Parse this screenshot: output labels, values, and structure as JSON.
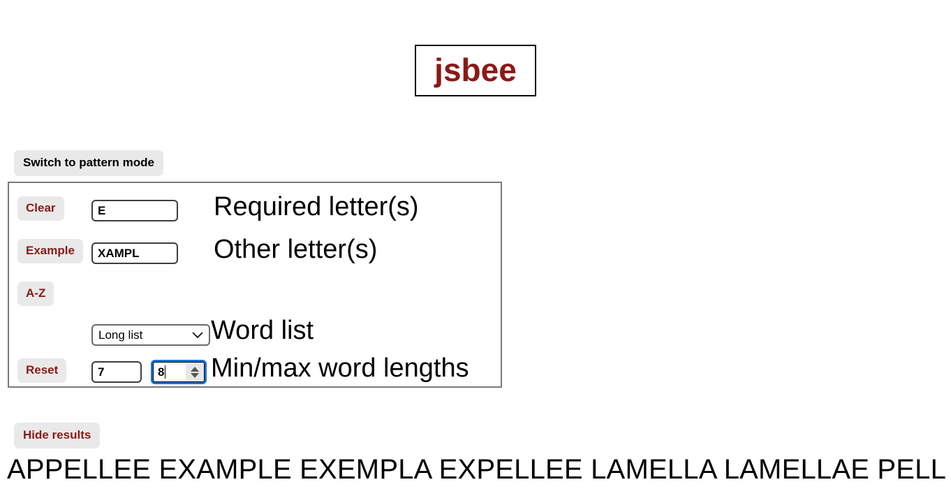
{
  "app": {
    "title": "jsbee"
  },
  "mode": {
    "switch_label": "Switch to pattern mode"
  },
  "panel": {
    "rows": [
      {
        "button": "Clear",
        "input_value": "E",
        "label": "Required letter(s)"
      },
      {
        "button": "Example",
        "input_value": "XAMPL",
        "label": "Other letter(s)"
      },
      {
        "button": "A-Z",
        "input_value": "",
        "label": ""
      },
      {
        "button": "",
        "select_value": "Long list",
        "label": "Word list"
      },
      {
        "button": "Reset",
        "min_value": "7",
        "max_value": "8",
        "label": "Min/max word lengths"
      }
    ],
    "wordlist_options": [
      "Long list"
    ]
  },
  "results": {
    "toggle_label": "Hide results",
    "words": [
      "APPELLEE",
      "EXAMPLE",
      "EXEMPLA",
      "EXPELLEE",
      "LAMELLA",
      "LAMELLAE",
      "PELLMELL"
    ],
    "text": "APPELLEE EXAMPLE EXEMPLA EXPELLEE LAMELLA LAMELLAE PELLMELL"
  },
  "colors": {
    "accent_red": "#8a1a16",
    "button_bg": "#e9e9e9",
    "panel_border": "#7a7a7a",
    "focus_ring": "#1a6fd4"
  }
}
